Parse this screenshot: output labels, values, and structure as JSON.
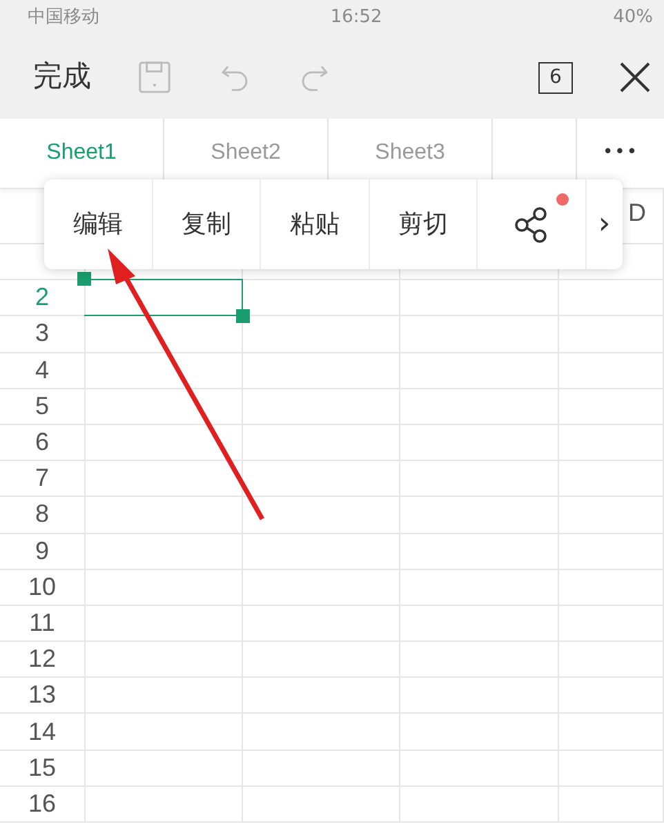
{
  "status_bar": {
    "carrier": "中国移动",
    "time": "16:52",
    "battery": "40%"
  },
  "toolbar": {
    "done": "完成",
    "buttons": [
      {
        "kind": "save",
        "disabled": true
      },
      {
        "kind": "undo",
        "disabled": true
      },
      {
        "kind": "redo",
        "disabled": true
      }
    ],
    "page_count": "6"
  },
  "sheet_tabs": [
    {
      "label": "Sheet1",
      "selected": true
    },
    {
      "label": "Sheet2",
      "selected": false
    },
    {
      "label": "Sheet3",
      "selected": false
    }
  ],
  "more_label": "•••",
  "column_headers": [
    "D"
  ],
  "rows": [
    {
      "number": "2",
      "selected": true
    },
    {
      "number": "3",
      "selected": false
    },
    {
      "number": "4",
      "selected": false
    },
    {
      "number": "5",
      "selected": false
    },
    {
      "number": "6",
      "selected": false
    },
    {
      "number": "7",
      "selected": false
    },
    {
      "number": "8",
      "selected": false
    },
    {
      "number": "9",
      "selected": false
    },
    {
      "number": "10",
      "selected": false
    },
    {
      "number": "11",
      "selected": false
    },
    {
      "number": "12",
      "selected": false
    },
    {
      "number": "13",
      "selected": false
    },
    {
      "number": "14",
      "selected": false
    },
    {
      "number": "15",
      "selected": false
    },
    {
      "number": "16",
      "selected": false
    }
  ],
  "context_menu": [
    {
      "kind": "text",
      "label": "编辑"
    },
    {
      "kind": "text",
      "label": "复制"
    },
    {
      "kind": "text",
      "label": "粘贴"
    },
    {
      "kind": "text",
      "label": "剪切"
    },
    {
      "kind": "share",
      "badge": true
    },
    {
      "kind": "more",
      "label": "›"
    }
  ]
}
